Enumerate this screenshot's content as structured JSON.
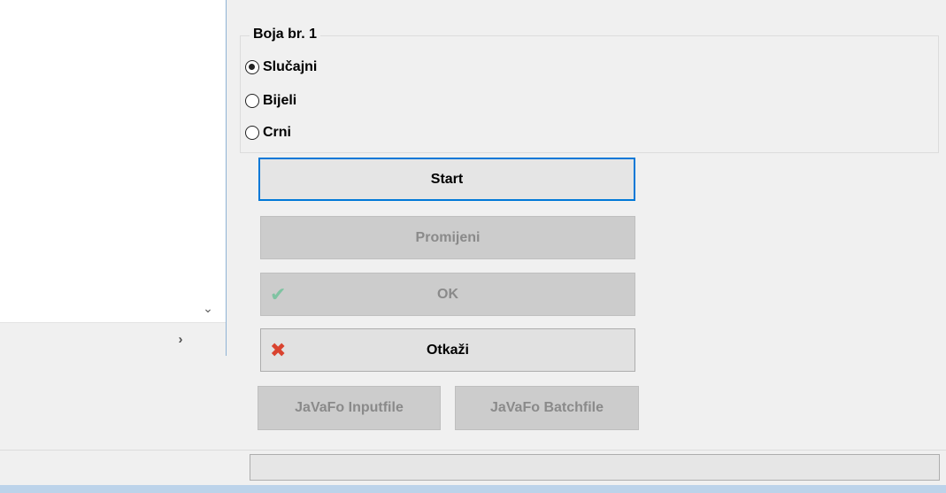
{
  "group": {
    "title": "Boja br. 1",
    "options": [
      {
        "label": "Slučajni",
        "checked": true
      },
      {
        "label": "Bijeli",
        "checked": false
      },
      {
        "label": "Crni",
        "checked": false
      }
    ]
  },
  "buttons": {
    "start": "Start",
    "change": "Promijeni",
    "ok": "OK",
    "cancel": "Otkaži",
    "javafo_input": "JaVaFo Inputfile",
    "javafo_batch": "JaVaFo Batchfile"
  },
  "icons": {
    "v_scroll": "chevron-down-icon",
    "h_scroll": "chevron-right-icon",
    "ok": "check-icon",
    "cancel": "x-icon"
  },
  "colors": {
    "focus_border": "#0078d7",
    "check_icon": "#7fc3a2",
    "x_icon": "#d9432f"
  },
  "status": {
    "text": ""
  }
}
